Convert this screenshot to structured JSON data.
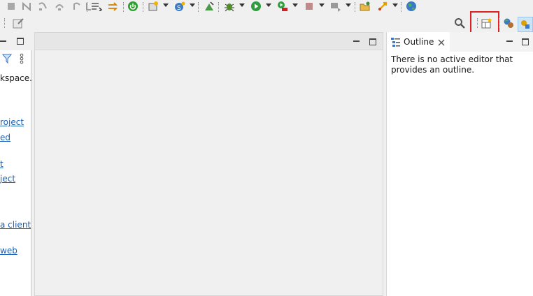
{
  "left_panel": {
    "partial_text": "kspace.",
    "links": [
      "roject",
      "ed ",
      "t",
      "ject",
      "a client",
      " web "
    ]
  },
  "outline": {
    "tab_label": "Outline",
    "message_line1": "There is no active editor that",
    "message_line2": "provides an outline."
  },
  "colors": {
    "highlight_border": "#e02020",
    "link": "#1a5fb4"
  }
}
